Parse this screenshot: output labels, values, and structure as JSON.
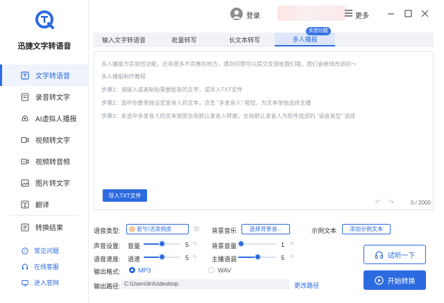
{
  "app": {
    "name": "迅捷文字转语音"
  },
  "sidebar": {
    "items": [
      {
        "label": "文字转语音",
        "icon": "text-to-speech-icon",
        "active": true
      },
      {
        "label": "录音转文字",
        "icon": "recording-icon"
      },
      {
        "label": "AI虚拟人播报",
        "icon": "ai-avatar-icon"
      },
      {
        "label": "视频转文字",
        "icon": "video-text-icon"
      },
      {
        "label": "视频转音频",
        "icon": "video-audio-icon"
      },
      {
        "label": "图片转文字",
        "icon": "image-text-icon"
      },
      {
        "label": "翻译",
        "icon": "translate-icon"
      }
    ],
    "result": {
      "label": "转换结果",
      "icon": "result-icon"
    },
    "links": [
      {
        "label": "常见问题",
        "icon": "question-icon"
      },
      {
        "label": "在线客服",
        "icon": "support-icon"
      },
      {
        "label": "进入官网",
        "icon": "website-icon"
      }
    ]
  },
  "topbar": {
    "login": "登录",
    "more": "更多"
  },
  "tabs": [
    {
      "label": "输入文字转语音"
    },
    {
      "label": "批量转写"
    },
    {
      "label": "长文本转写"
    },
    {
      "label": "多人播报",
      "active": true
    }
  ],
  "badge": "实验功能",
  "editor": {
    "lines": [
      "多人播报为实验性功能，还有很多不完善的地方，遇到问题可以提交反馈给我们哦，我们会继续改进的～",
      "多人播报制作教程",
      "步骤1：请输入或者粘贴需要配音的文字，或导入TXT文件",
      "步骤2：选中你要单独设定发音人的文本，点击 “多发音人” 按钮，为文本单独选择主播",
      "步骤3：未选中多发音人的文本按照全局默认发音人转换，全局默认发音人为软件底部的 “语音类型” 选择"
    ],
    "import_label": "导入TXT文件",
    "count": "0 / 2000"
  },
  "settings": {
    "voice_type_label": "语音类型:",
    "voice_value": "若兮/活泼俏皮",
    "bg_music_label": "背景音乐",
    "bg_music_btn": "选择背景音...",
    "sample_label": "示例文本",
    "sample_btn": "添加示例文本",
    "sound_label": "声音设置:",
    "volume_label": "音量",
    "volume_value": "5",
    "volume_fraction": 0.5,
    "bg_volume_label": "背景音量",
    "bg_volume_value": "1",
    "bg_volume_fraction": 0.0,
    "speed_label": "语音速度:",
    "speed_sub_label": "语速",
    "speed_value": "5",
    "speed_fraction": 0.5,
    "tone_label": "主播语调",
    "tone_value": "5",
    "tone_fraction": 0.5,
    "format_label": "输出格式:",
    "format_options": [
      "MP3",
      "WAV"
    ],
    "format_selected": "MP3",
    "path_label": "输出路径:",
    "path_value": "C:\\Users\\linfu\\desktop",
    "change_path": "更改路径",
    "listen_btn": "试听一下",
    "start_btn": "开始转换"
  },
  "colors": {
    "accent": "#2c6ae0"
  }
}
